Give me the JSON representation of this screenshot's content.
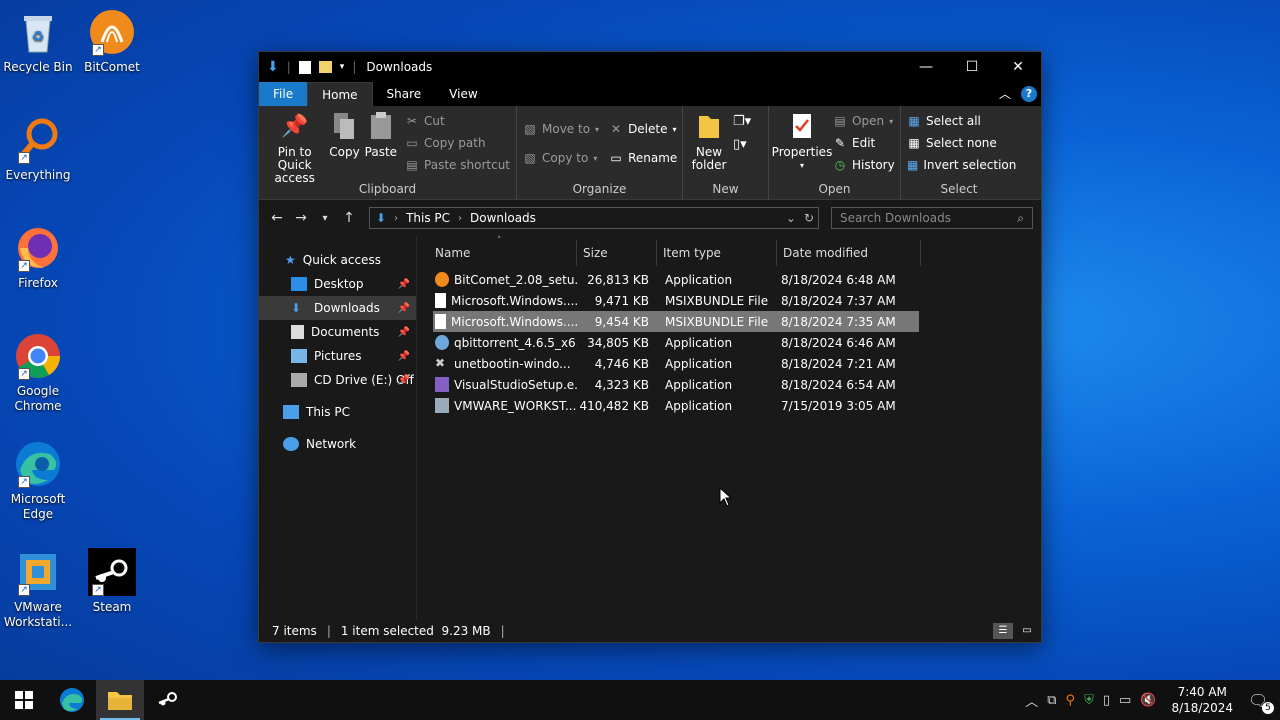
{
  "desktop": {
    "icons": [
      {
        "label": "Recycle Bin"
      },
      {
        "label": "BitComet"
      },
      {
        "label": "Everything"
      },
      {
        "label": "Firefox"
      },
      {
        "label": "Google Chrome"
      },
      {
        "label": "Microsoft Edge"
      },
      {
        "label": "VMware Workstati..."
      },
      {
        "label": "Steam"
      }
    ]
  },
  "window": {
    "title": "Downloads",
    "controls": {
      "minimize": "—",
      "maximize": "☐",
      "close": "✕"
    },
    "tabs": [
      "File",
      "Home",
      "Share",
      "View"
    ],
    "ribbon": {
      "clipboard": {
        "label": "Clipboard",
        "pin": "Pin to Quick access",
        "copy": "Copy",
        "paste": "Paste",
        "cut": "Cut",
        "copy_path": "Copy path",
        "paste_shortcut": "Paste shortcut"
      },
      "organize": {
        "label": "Organize",
        "move_to": "Move to",
        "copy_to": "Copy to",
        "delete": "Delete",
        "rename": "Rename"
      },
      "new": {
        "label": "New",
        "new_folder": "New folder"
      },
      "open": {
        "label": "Open",
        "properties": "Properties",
        "open": "Open",
        "edit": "Edit",
        "history": "History"
      },
      "select": {
        "label": "Select",
        "select_all": "Select all",
        "select_none": "Select none",
        "invert": "Invert selection"
      }
    },
    "address": {
      "crumbs": [
        "This PC",
        "Downloads"
      ],
      "search_placeholder": "Search Downloads"
    },
    "nav": {
      "quick_access": "Quick access",
      "items": [
        {
          "label": "Desktop",
          "pinned": true
        },
        {
          "label": "Downloads",
          "pinned": true,
          "selected": true
        },
        {
          "label": "Documents",
          "pinned": true
        },
        {
          "label": "Pictures",
          "pinned": true
        },
        {
          "label": "CD Drive (E:) Off",
          "pinned": true
        }
      ],
      "this_pc": "This PC",
      "network": "Network"
    },
    "columns": {
      "name": "Name",
      "size": "Size",
      "type": "Item type",
      "date": "Date modified"
    },
    "files": [
      {
        "name": "BitComet_2.08_setu...",
        "size": "26,813 KB",
        "type": "Application",
        "date": "8/18/2024 6:48 AM",
        "icon": "bitcomet-icon"
      },
      {
        "name": "Microsoft.Windows....",
        "size": "9,471 KB",
        "type": "MSIXBUNDLE File",
        "date": "8/18/2024 7:37 AM",
        "icon": "file-icon"
      },
      {
        "name": "Microsoft.Windows....",
        "size": "9,454 KB",
        "type": "MSIXBUNDLE File",
        "date": "8/18/2024 7:35 AM",
        "icon": "file-icon",
        "selected": true
      },
      {
        "name": "qbittorrent_4.6.5_x6...",
        "size": "34,805 KB",
        "type": "Application",
        "date": "8/18/2024 6:46 AM",
        "icon": "qbittorrent-icon"
      },
      {
        "name": "unetbootin-windo...",
        "size": "4,746 KB",
        "type": "Application",
        "date": "8/18/2024 7:21 AM",
        "icon": "unetbootin-icon"
      },
      {
        "name": "VisualStudioSetup.e...",
        "size": "4,323 KB",
        "type": "Application",
        "date": "8/18/2024 6:54 AM",
        "icon": "visualstudio-icon"
      },
      {
        "name": "VMWARE_WORKST...",
        "size": "410,482 KB",
        "type": "Application",
        "date": "7/15/2019 3:05 AM",
        "icon": "vmware-icon"
      }
    ],
    "status": {
      "count": "7 items",
      "selection": "1 item selected  9.23 MB"
    }
  },
  "taskbar": {
    "time": "7:40 AM",
    "date": "8/18/2024",
    "notifications": "5"
  }
}
